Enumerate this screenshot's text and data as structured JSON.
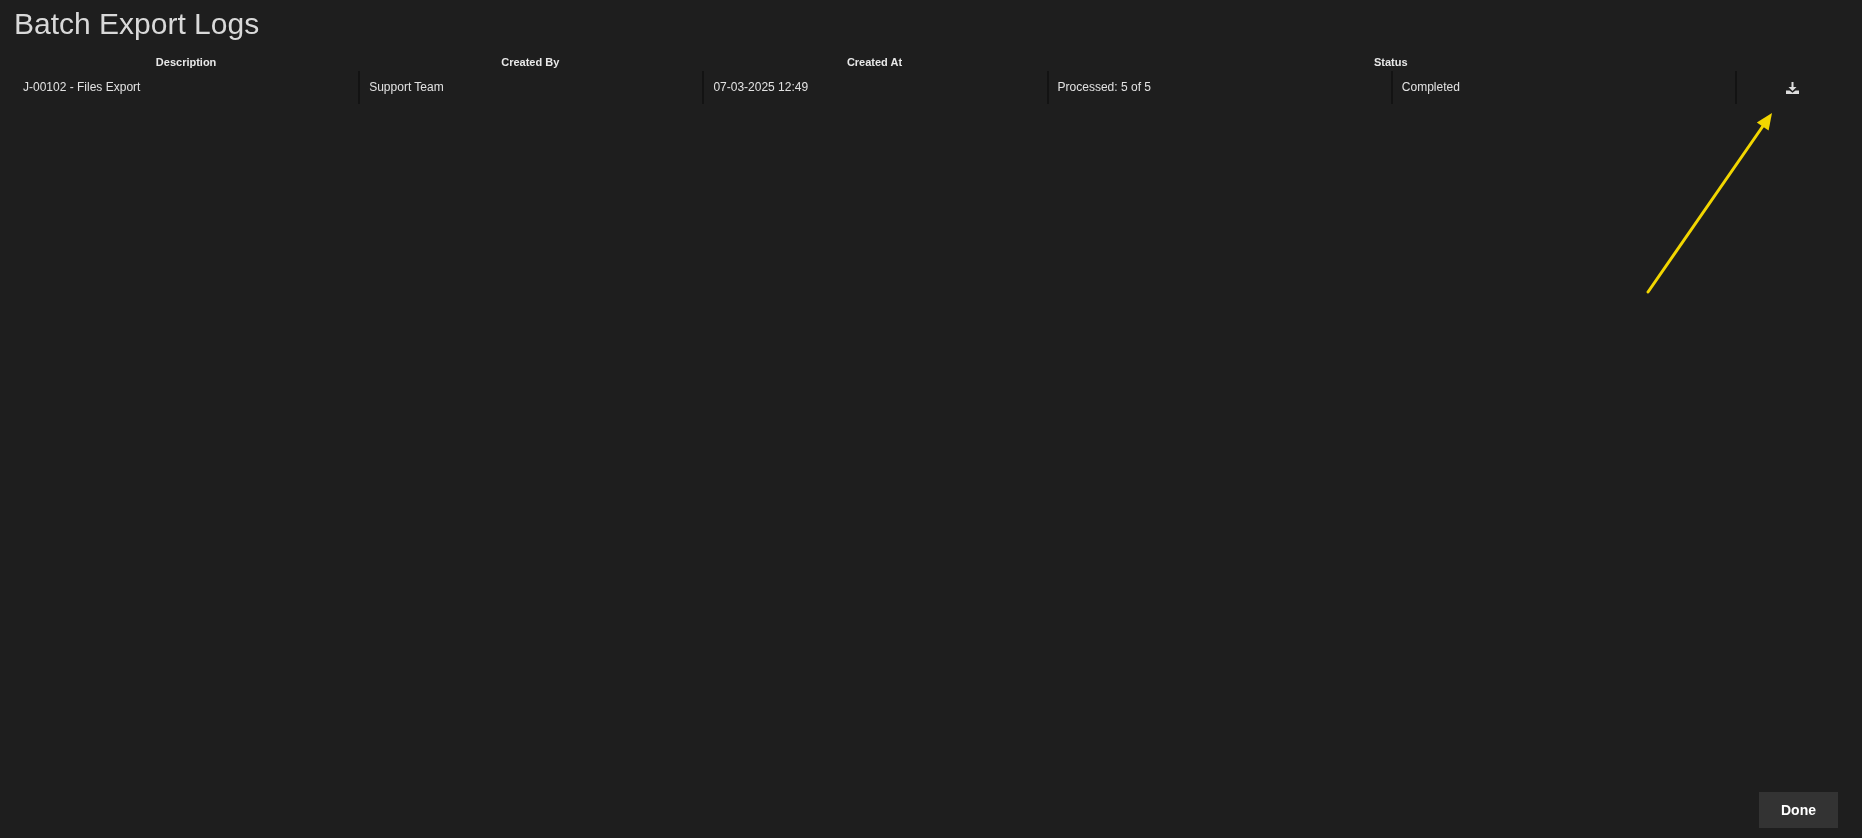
{
  "title": "Batch Export Logs",
  "table": {
    "columns": [
      "Description",
      "Created By",
      "Created At",
      "Status"
    ],
    "rows": [
      {
        "cells": [
          "J-00102 - Files Export",
          "Support Team",
          "07-03-2025 12:49",
          "Processed: 5 of 5",
          "Completed"
        ]
      }
    ]
  },
  "buttons": [
    "Done"
  ]
}
